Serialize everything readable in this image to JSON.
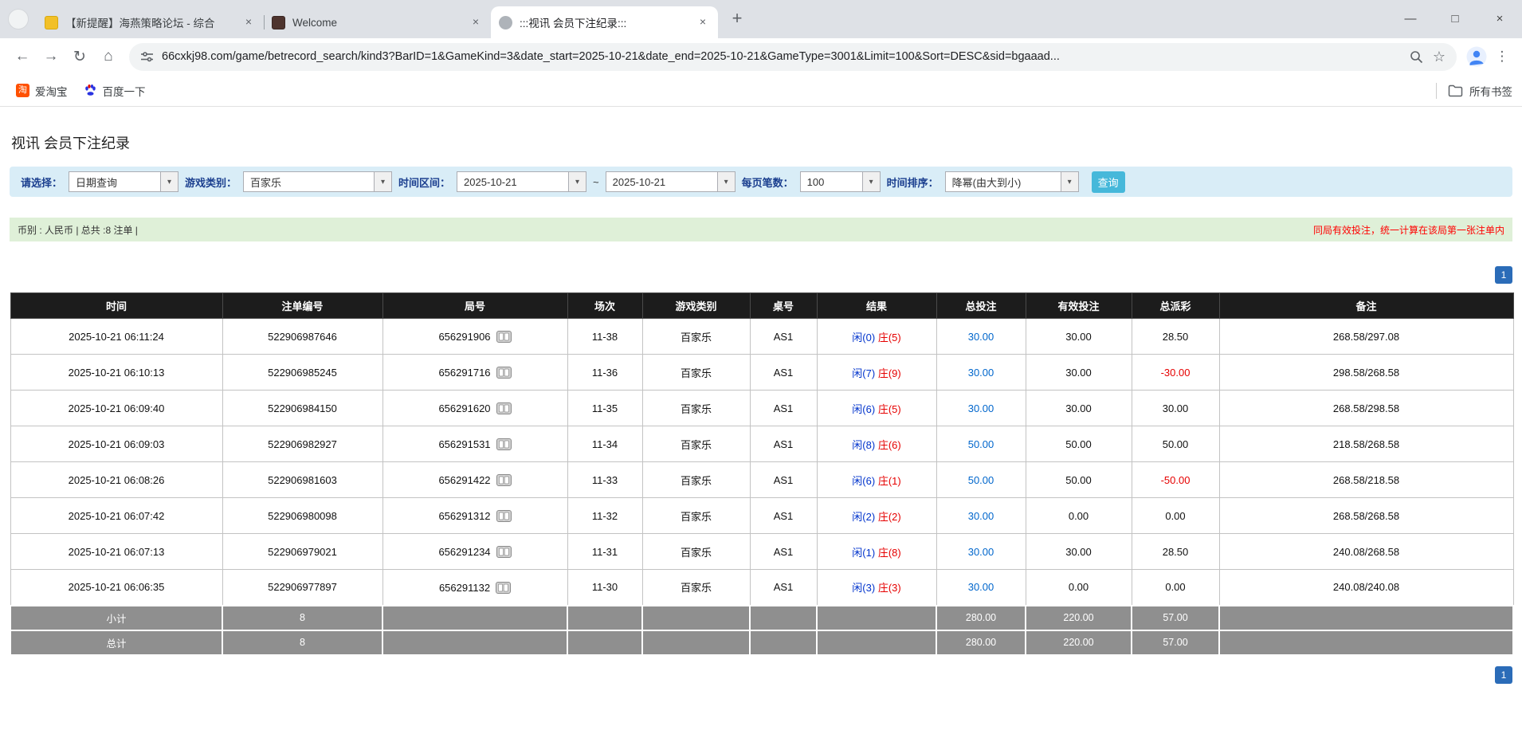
{
  "colors": {
    "filter_bg": "#d9edf7",
    "summary_bg": "#dff0d8",
    "label_blue": "#1b3f8f",
    "button_bg": "#46b8da",
    "pager_bg": "#2b6cb8",
    "header_bg": "#1c1c1c",
    "footer_bg": "#8f8f8f",
    "link_blue": "#0066cc",
    "player_blue": "#0033cc",
    "banker_red": "#e60000",
    "negative_red": "#e60000"
  },
  "icons": {
    "back": "←",
    "forward": "→",
    "refresh": "↻",
    "home": "⌂",
    "close_tab": "×",
    "new_tab": "+",
    "minimize": "—",
    "maximize": "□",
    "close_window": "×",
    "menu": "⋮",
    "star": "☆",
    "dropdown": "▾"
  },
  "browser": {
    "tabs": [
      {
        "title": "【新提醒】海燕策略论坛 - 综合"
      },
      {
        "title": "Welcome"
      },
      {
        "title": ":::视讯 会员下注纪录:::"
      }
    ],
    "url": "66cxkj98.com/game/betrecord_search/kind3?BarID=1&GameKind=3&date_start=2025-10-21&date_end=2025-10-21&GameType=3001&Limit=100&Sort=DESC&sid=bgaaad...",
    "bookmarks": [
      {
        "label": "爱淘宝",
        "icon_text": "淘"
      },
      {
        "label": "百度一下"
      }
    ],
    "all_bookmarks_label": "所有书签"
  },
  "page": {
    "title": "视讯 会员下注纪录",
    "filters": {
      "select_label": "请选择：",
      "select_value": "日期查询",
      "game_label": "游戏类别：",
      "game_value": "百家乐",
      "range_label": "时间区间：",
      "date_start": "2025-10-21",
      "tilde": "~",
      "date_end": "2025-10-21",
      "per_page_label": "每页笔数：",
      "per_page_value": "100",
      "sort_label": "时间排序：",
      "sort_value": "降幂(由大到小)",
      "search_button": "查询"
    },
    "summary": {
      "left": "币别 : 人民币 | 总共 :8 注单 |",
      "right": "同局有效投注，统一计算在该局第一张注单内"
    },
    "pagination": "1",
    "table": {
      "headers": [
        "时间",
        "注单编号",
        "局号",
        "场次",
        "游戏类别",
        "桌号",
        "结果",
        "总投注",
        "有效投注",
        "总派彩",
        "备注"
      ],
      "rows": [
        {
          "time": "2025-10-21 06:11:24",
          "bet_id": "522906987646",
          "round": "656291906",
          "session": "11-38",
          "game": "百家乐",
          "table": "AS1",
          "player": "闲(0)",
          "banker": "庄(5)",
          "total_bet": "30.00",
          "valid_bet": "30.00",
          "payout": "28.50",
          "note": "268.58/297.08"
        },
        {
          "time": "2025-10-21 06:10:13",
          "bet_id": "522906985245",
          "round": "656291716",
          "session": "11-36",
          "game": "百家乐",
          "table": "AS1",
          "player": "闲(7)",
          "banker": "庄(9)",
          "total_bet": "30.00",
          "valid_bet": "30.00",
          "payout": "-30.00",
          "note": "298.58/268.58"
        },
        {
          "time": "2025-10-21 06:09:40",
          "bet_id": "522906984150",
          "round": "656291620",
          "session": "11-35",
          "game": "百家乐",
          "table": "AS1",
          "player": "闲(6)",
          "banker": "庄(5)",
          "total_bet": "30.00",
          "valid_bet": "30.00",
          "payout": "30.00",
          "note": "268.58/298.58"
        },
        {
          "time": "2025-10-21 06:09:03",
          "bet_id": "522906982927",
          "round": "656291531",
          "session": "11-34",
          "game": "百家乐",
          "table": "AS1",
          "player": "闲(8)",
          "banker": "庄(6)",
          "total_bet": "50.00",
          "valid_bet": "50.00",
          "payout": "50.00",
          "note": "218.58/268.58"
        },
        {
          "time": "2025-10-21 06:08:26",
          "bet_id": "522906981603",
          "round": "656291422",
          "session": "11-33",
          "game": "百家乐",
          "table": "AS1",
          "player": "闲(6)",
          "banker": "庄(1)",
          "total_bet": "50.00",
          "valid_bet": "50.00",
          "payout": "-50.00",
          "note": "268.58/218.58"
        },
        {
          "time": "2025-10-21 06:07:42",
          "bet_id": "522906980098",
          "round": "656291312",
          "session": "11-32",
          "game": "百家乐",
          "table": "AS1",
          "player": "闲(2)",
          "banker": "庄(2)",
          "total_bet": "30.00",
          "valid_bet": "0.00",
          "payout": "0.00",
          "note": "268.58/268.58"
        },
        {
          "time": "2025-10-21 06:07:13",
          "bet_id": "522906979021",
          "round": "656291234",
          "session": "11-31",
          "game": "百家乐",
          "table": "AS1",
          "player": "闲(1)",
          "banker": "庄(8)",
          "total_bet": "30.00",
          "valid_bet": "30.00",
          "payout": "28.50",
          "note": "240.08/268.58"
        },
        {
          "time": "2025-10-21 06:06:35",
          "bet_id": "522906977897",
          "round": "656291132",
          "session": "11-30",
          "game": "百家乐",
          "table": "AS1",
          "player": "闲(3)",
          "banker": "庄(3)",
          "total_bet": "30.00",
          "valid_bet": "0.00",
          "payout": "0.00",
          "note": "240.08/240.08"
        }
      ],
      "footer_rows": [
        {
          "name": "subtotal",
          "cells": [
            "小计",
            "8",
            "",
            "",
            "",
            "",
            "",
            "280.00",
            "220.00",
            "57.00",
            ""
          ]
        },
        {
          "name": "total",
          "cells": [
            "总计",
            "8",
            "",
            "",
            "",
            "",
            "",
            "280.00",
            "220.00",
            "57.00",
            ""
          ]
        }
      ]
    }
  }
}
